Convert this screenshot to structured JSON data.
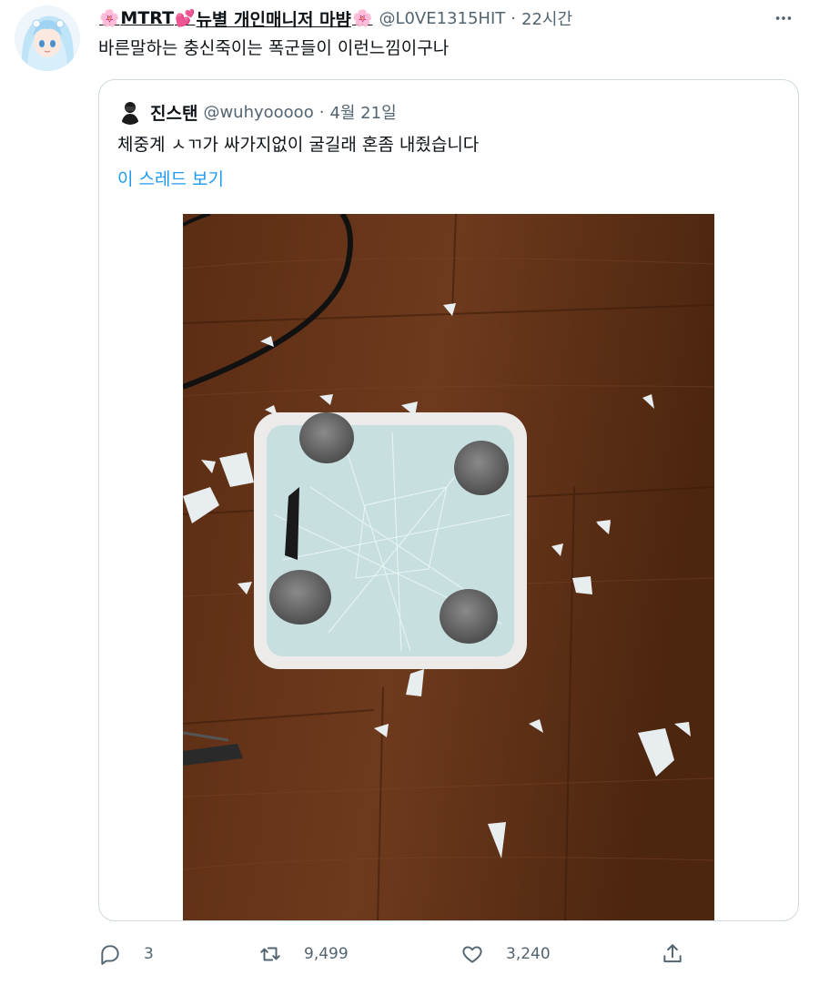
{
  "tweet": {
    "author": {
      "display_name_prefix_emoji": "🌸",
      "display_name": "MTRT",
      "display_name_heart_emoji": "💕",
      "display_name_rest": "뉴별 개인매니저 마뱜",
      "display_name_suffix_emoji": "🌸",
      "handle": "@L0VE1315HIT",
      "separator": "·",
      "time": "22시간"
    },
    "text": "바른말하는 충신죽이는 폭군들이 이런느낌이구나",
    "quoted": {
      "author_name": "진스탠",
      "handle": "@wuhyooooo",
      "separator": "·",
      "date": "4월 21일",
      "text": "체중계 ㅅㄲ가 싸가지없이 굴길래 혼좀 내줬습니다",
      "thread_link": "이 스레드 보기"
    },
    "actions": {
      "reply_count": "3",
      "retweet_count": "9,499",
      "like_count": "3,240"
    }
  },
  "colors": {
    "text_primary": "#0f1419",
    "text_secondary": "#536471",
    "link": "#1d9bf0",
    "border": "#cfd9de",
    "floor": "#5a2e17"
  },
  "icons": [
    "more-icon",
    "reply-icon",
    "retweet-icon",
    "like-icon",
    "share-icon"
  ]
}
